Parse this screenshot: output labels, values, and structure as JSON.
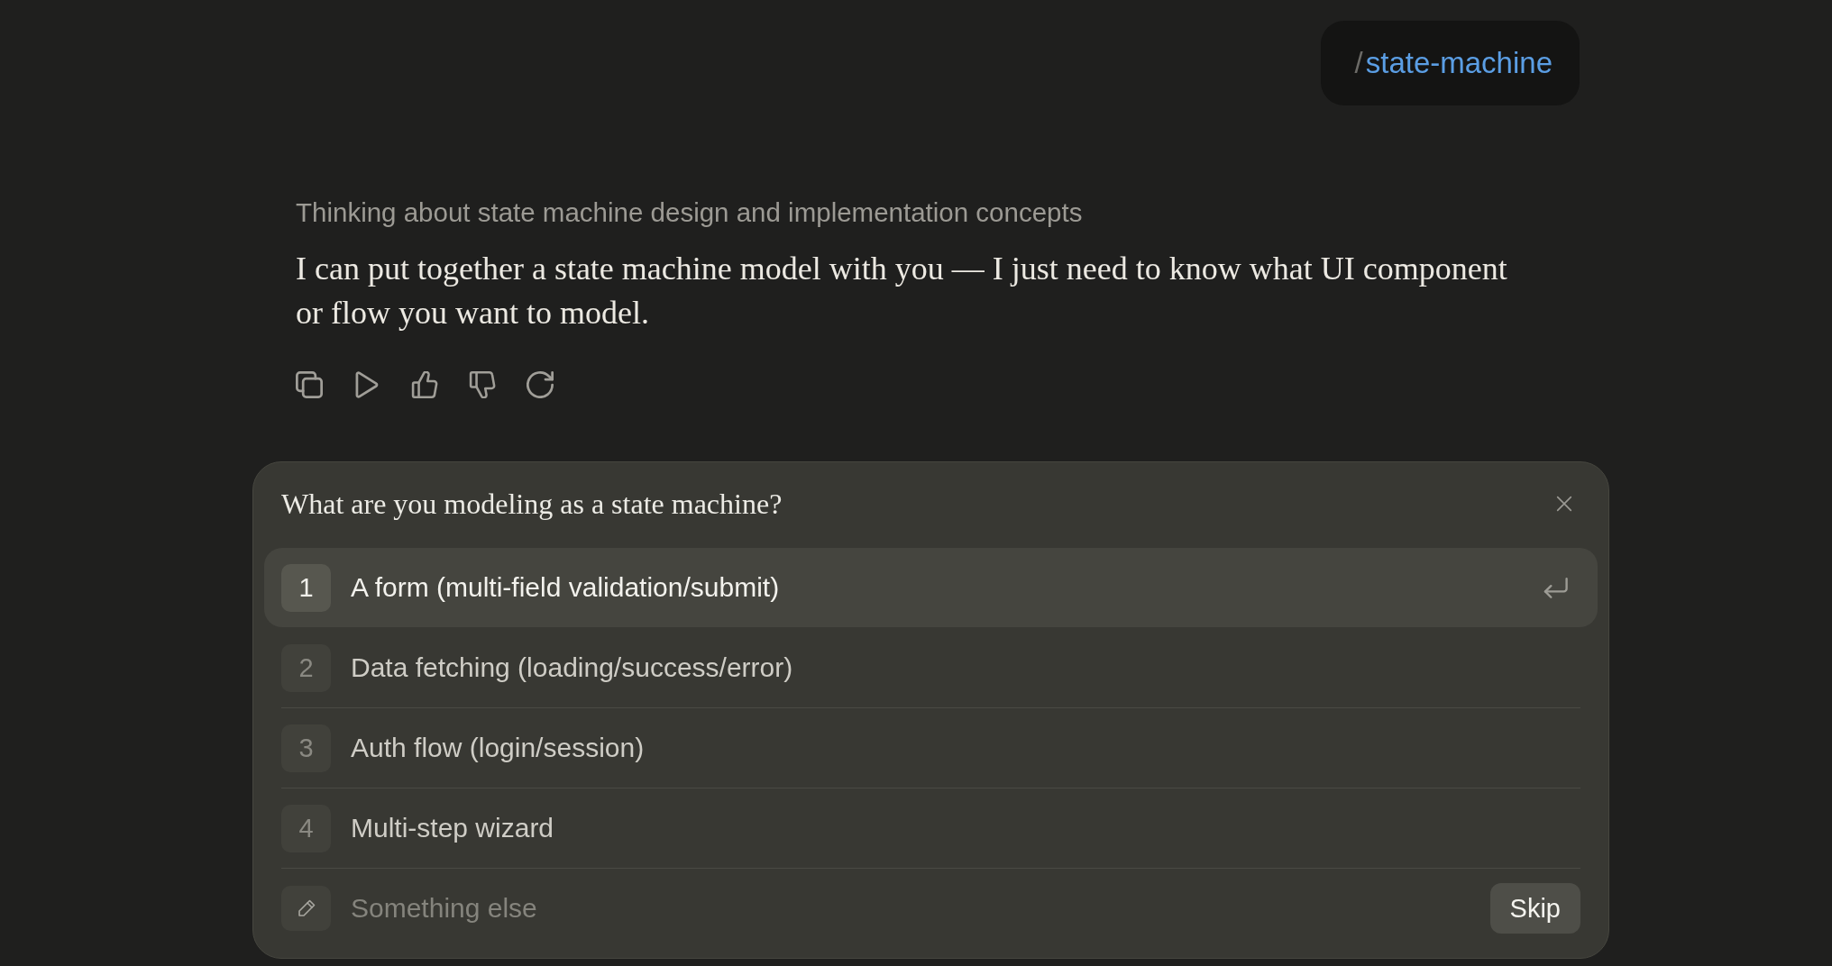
{
  "user_message": {
    "slash": "/",
    "command": "state-machine"
  },
  "response": {
    "thinking": "Thinking about state machine design and implementation concepts",
    "message": "I can put together a state machine model with you — I just need to know what UI component or flow you want to model."
  },
  "question": {
    "title": "What are you modeling as a state machine?",
    "options": [
      {
        "number": "1",
        "label": "A form (multi-field validation/submit)",
        "selected": true
      },
      {
        "number": "2",
        "label": "Data fetching (loading/success/error)",
        "selected": false
      },
      {
        "number": "3",
        "label": "Auth flow (login/session)",
        "selected": false
      },
      {
        "number": "4",
        "label": "Multi-step wizard",
        "selected": false
      }
    ],
    "other": {
      "placeholder": "Something else"
    },
    "skip_button": "Skip"
  }
}
